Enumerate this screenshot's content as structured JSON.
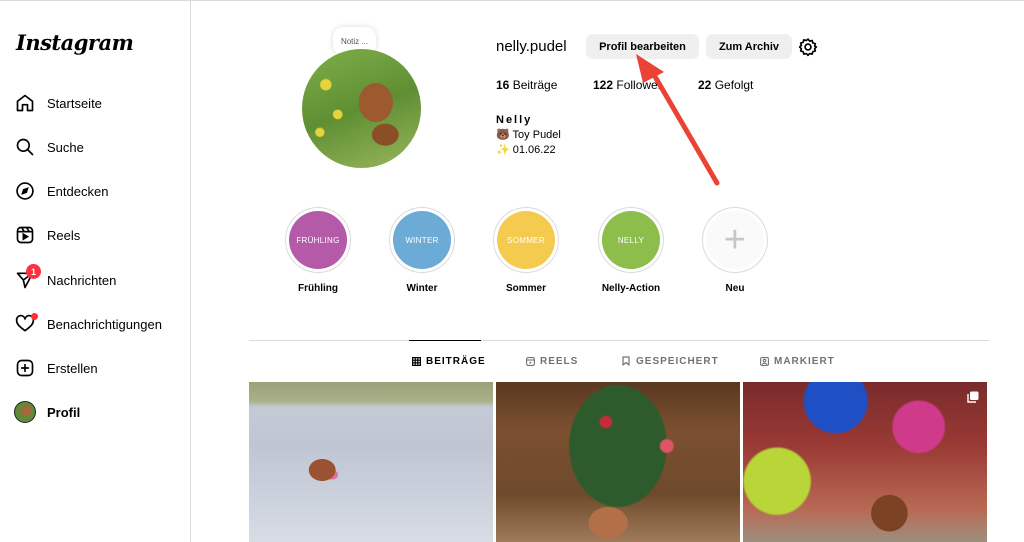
{
  "app": {
    "logo": "Instagram"
  },
  "sidebar": {
    "items": [
      {
        "label": "Startseite",
        "icon": "home-icon"
      },
      {
        "label": "Suche",
        "icon": "search-icon"
      },
      {
        "label": "Entdecken",
        "icon": "compass-icon"
      },
      {
        "label": "Reels",
        "icon": "reels-icon"
      },
      {
        "label": "Nachrichten",
        "icon": "messenger-icon",
        "badge": "1"
      },
      {
        "label": "Benachrichtigungen",
        "icon": "heart-icon"
      },
      {
        "label": "Erstellen",
        "icon": "plus-square-icon"
      },
      {
        "label": "Profil",
        "icon": "avatar"
      }
    ]
  },
  "profile": {
    "note": "Notiz ...",
    "username": "nelly.pudel",
    "edit_button": "Profil bearbeiten",
    "archive_button": "Zum Archiv",
    "stats": {
      "posts_count": "16",
      "posts_label": "Beiträge",
      "followers_count": "122",
      "followers_label": "Follower",
      "following_count": "22",
      "following_label": "Gefolgt"
    },
    "full_name": "Nelly",
    "bio_line1": "🐻 Toy Pudel",
    "bio_line2": "✨ 01.06.22"
  },
  "highlights": [
    {
      "title": "Frühling",
      "cover_text": "FRÜHLING",
      "color": "#b45aa8"
    },
    {
      "title": "Winter",
      "cover_text": "WINTER",
      "color": "#6cabd6"
    },
    {
      "title": "Sommer",
      "cover_text": "SOMMER",
      "color": "#f5cb4f"
    },
    {
      "title": "Nelly-Action",
      "cover_text": "NELLY",
      "color": "#8dbd4b"
    },
    {
      "title": "Neu",
      "cover_text": "+",
      "color": "#fafafa"
    }
  ],
  "tabs": [
    {
      "label": "BEITRÄGE",
      "icon": "grid-icon"
    },
    {
      "label": "REELS",
      "icon": "reels-icon"
    },
    {
      "label": "GESPEICHERT",
      "icon": "bookmark-icon"
    },
    {
      "label": "MARKIERT",
      "icon": "tagged-icon"
    }
  ],
  "colors": {
    "accent_red": "#ff3040",
    "annotation_arrow": "#ea4335",
    "button_bg": "#efefef"
  }
}
